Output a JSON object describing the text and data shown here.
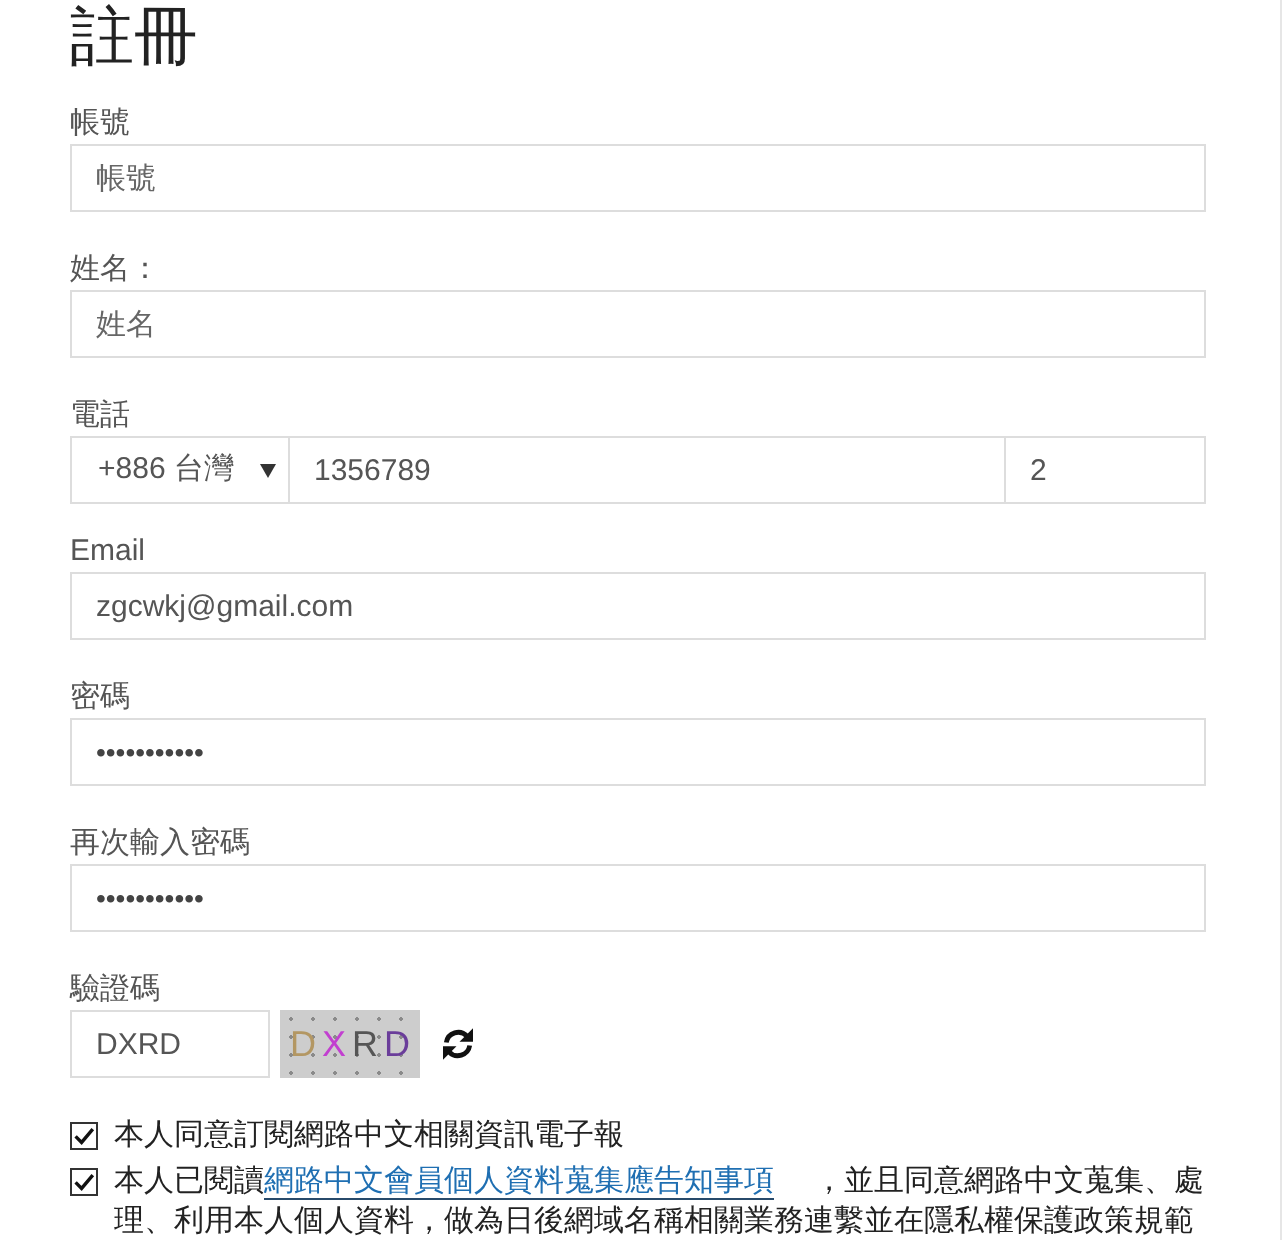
{
  "title": "註冊",
  "fields": [
    {
      "kind": "text",
      "label": "帳號",
      "placeholder": "帳號"
    },
    {
      "kind": "text",
      "label": "姓名：",
      "placeholder": "姓名"
    },
    {
      "kind": "phone",
      "label": "電話",
      "country": "+886 台灣",
      "number": "1356789",
      "extension": "2"
    },
    {
      "kind": "text",
      "label": "Email",
      "value": "zgcwkj@gmail.com"
    },
    {
      "kind": "password",
      "label": "密碼",
      "value": "•••••••••••"
    },
    {
      "kind": "password",
      "label": "再次輸入密碼",
      "value": "•••••••••••"
    },
    {
      "kind": "captcha",
      "label": "驗證碼",
      "value": "DXRD",
      "image_text": "DXRD"
    }
  ],
  "agreements": [
    {
      "checked": true,
      "text": "本人同意訂閱網路中文相關資訊電子報"
    },
    {
      "checked": true,
      "text": "本人已閱讀",
      "link": "網路中文會員個人資料蒐集應告知事項",
      "text_after": "，並且同意網路中文蒐集、處理、利用本人個人資料，做為日後網域名稱相關業務連繫並在隱私權保護政策規範"
    }
  ]
}
